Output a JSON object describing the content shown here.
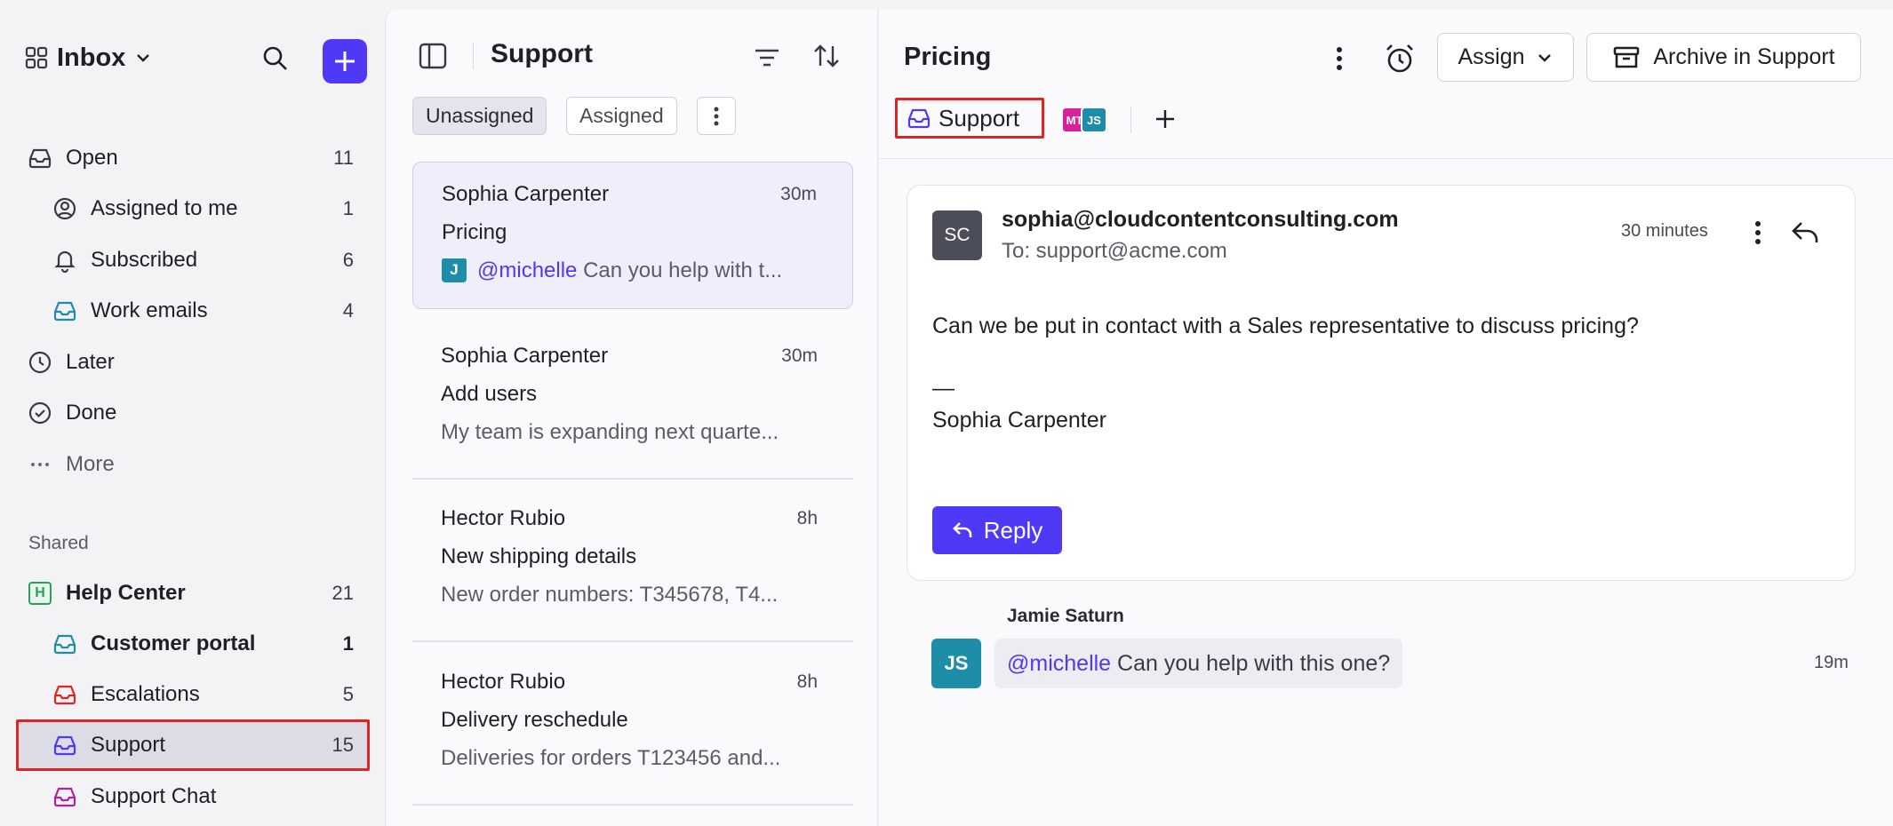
{
  "sidebar": {
    "inbox_title": "Inbox",
    "items": [
      {
        "label": "Open",
        "count": "11"
      },
      {
        "label": "Assigned to me",
        "count": "1"
      },
      {
        "label": "Subscribed",
        "count": "6"
      },
      {
        "label": "Work emails",
        "count": "4"
      },
      {
        "label": "Later",
        "count": ""
      },
      {
        "label": "Done",
        "count": ""
      },
      {
        "label": "More",
        "count": ""
      }
    ],
    "shared_label": "Shared",
    "shared": [
      {
        "label": "Help Center",
        "count": "21",
        "badge": "H"
      },
      {
        "label": "Customer portal",
        "count": "1"
      },
      {
        "label": "Escalations",
        "count": "5"
      },
      {
        "label": "Support",
        "count": "15"
      },
      {
        "label": "Support Chat",
        "count": ""
      }
    ]
  },
  "list": {
    "title": "Support",
    "tabs": [
      "Unassigned",
      "Assigned"
    ],
    "conversations": [
      {
        "sender": "Sophia Carpenter",
        "time": "30m",
        "subject": "Pricing",
        "avatar": "J",
        "mention": "@michelle",
        "preview": "Can you help with t..."
      },
      {
        "sender": "Sophia Carpenter",
        "time": "30m",
        "subject": "Add users",
        "preview": "My team is expanding next quarte..."
      },
      {
        "sender": "Hector Rubio",
        "time": "8h",
        "subject": "New shipping details",
        "preview": "New order numbers: T345678, T4..."
      },
      {
        "sender": "Hector Rubio",
        "time": "8h",
        "subject": "Delivery reschedule",
        "preview": "Deliveries for orders T123456 and..."
      }
    ]
  },
  "detail": {
    "title": "Pricing",
    "assign_label": "Assign",
    "archive_label": "Archive in Support",
    "inbox_tag": "Support",
    "participants": [
      "MT",
      "JS"
    ],
    "message": {
      "avatar": "SC",
      "from": "sophia@cloudcontentconsulting.com",
      "to": "To: support@acme.com",
      "time": "30 minutes",
      "body": "Can we be put in contact with a Sales representative to discuss pricing?",
      "sig_dash": "—",
      "signature": "Sophia Carpenter",
      "reply_label": "Reply"
    },
    "comment": {
      "author": "Jamie Saturn",
      "avatar": "JS",
      "mention": "@michelle",
      "text": "Can you help with this one?",
      "time": "19m"
    }
  },
  "colors": {
    "accent": "#4f39f6",
    "highlight_border": "#e02424",
    "teal_avatar": "#1e8ea8",
    "magenta_avatar": "#d6219a"
  }
}
